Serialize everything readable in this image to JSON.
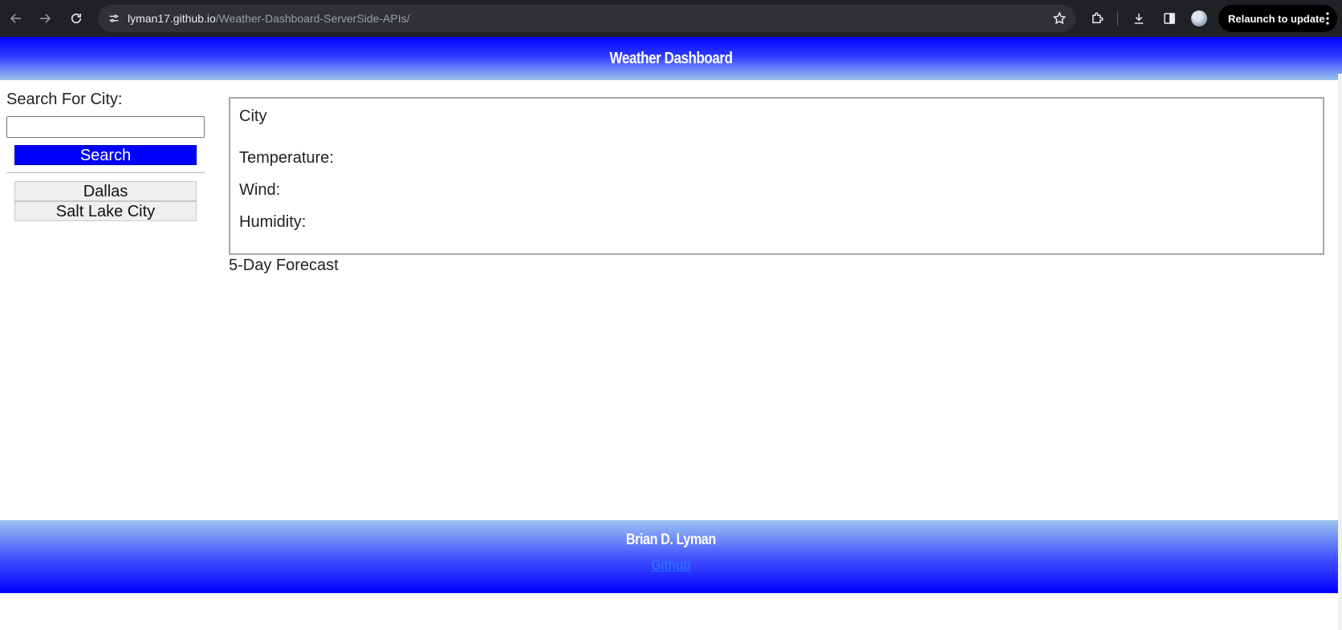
{
  "browser": {
    "url_host": "lyman17.github.io",
    "url_path": "/Weather-Dashboard-ServerSide-APIs/",
    "relaunch_label": "Relaunch to update"
  },
  "header": {
    "title": "Weather Dashboard"
  },
  "sidebar": {
    "search_label": "Search For City:",
    "search_value": "",
    "search_placeholder": "",
    "search_button_label": "Search",
    "history": [
      {
        "label": "Dallas"
      },
      {
        "label": "Salt Lake City"
      }
    ]
  },
  "current": {
    "city": "City",
    "temperature_label": "Temperature:",
    "wind_label": "Wind:",
    "humidity_label": "Humidity:"
  },
  "forecast": {
    "title": "5-Day Forecast"
  },
  "footer": {
    "author": "Brian D. Lyman",
    "link_label": "Github"
  },
  "colors": {
    "header_top": "#0000ff",
    "header_bottom": "#9cc3ef",
    "search_button": "#0000ff",
    "chrome_bg": "#202124"
  },
  "icons": {
    "back": "arrow-left-icon",
    "forward": "arrow-right-icon",
    "reload": "reload-icon",
    "site_info": "tune-icon",
    "bookmark": "star-icon",
    "extensions": "puzzle-icon",
    "downloads": "download-icon",
    "side_panel": "side-panel-icon",
    "profile": "avatar",
    "menu": "kebab-menu-icon"
  }
}
